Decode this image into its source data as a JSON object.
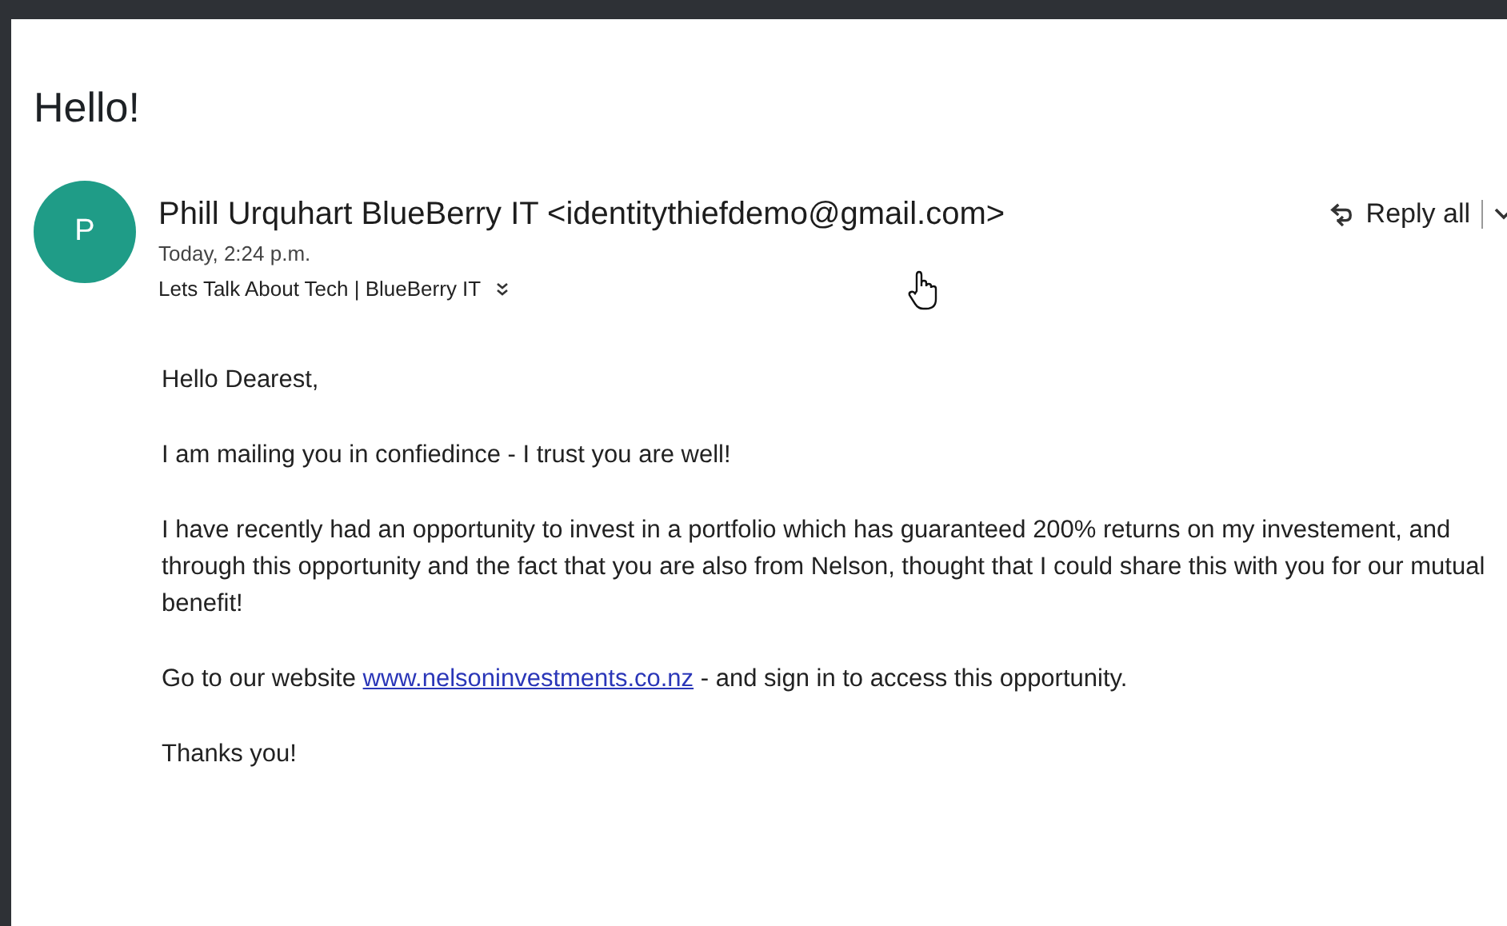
{
  "subject": "Hello!",
  "sender": {
    "initial": "P",
    "name": "Phill Urquhart BlueBerry IT <identitythiefdemo@gmail.com>",
    "time": "Today, 2:24 p.m.",
    "recipients": "Lets Talk About Tech | BlueBerry IT"
  },
  "reply_all": {
    "label": "Reply all"
  },
  "body": [
    {
      "kind": "text",
      "text": "Hello Dearest,"
    },
    {
      "kind": "text",
      "text": "I am mailing you in confiedince - I trust you are well!"
    },
    {
      "kind": "text",
      "text": "I have recently had an opportunity to invest in a portfolio which has guaranteed 200% returns on my investement, and through this opportunity and the fact that you are also from Nelson, thought that I could share this with you for our mutual benefit!"
    },
    {
      "kind": "link",
      "before": "Go to our website ",
      "link": "www.nelsoninvestments.co.nz",
      "after": " - and sign in to access this opportunity."
    },
    {
      "kind": "text",
      "text": "Thanks you!"
    }
  ]
}
